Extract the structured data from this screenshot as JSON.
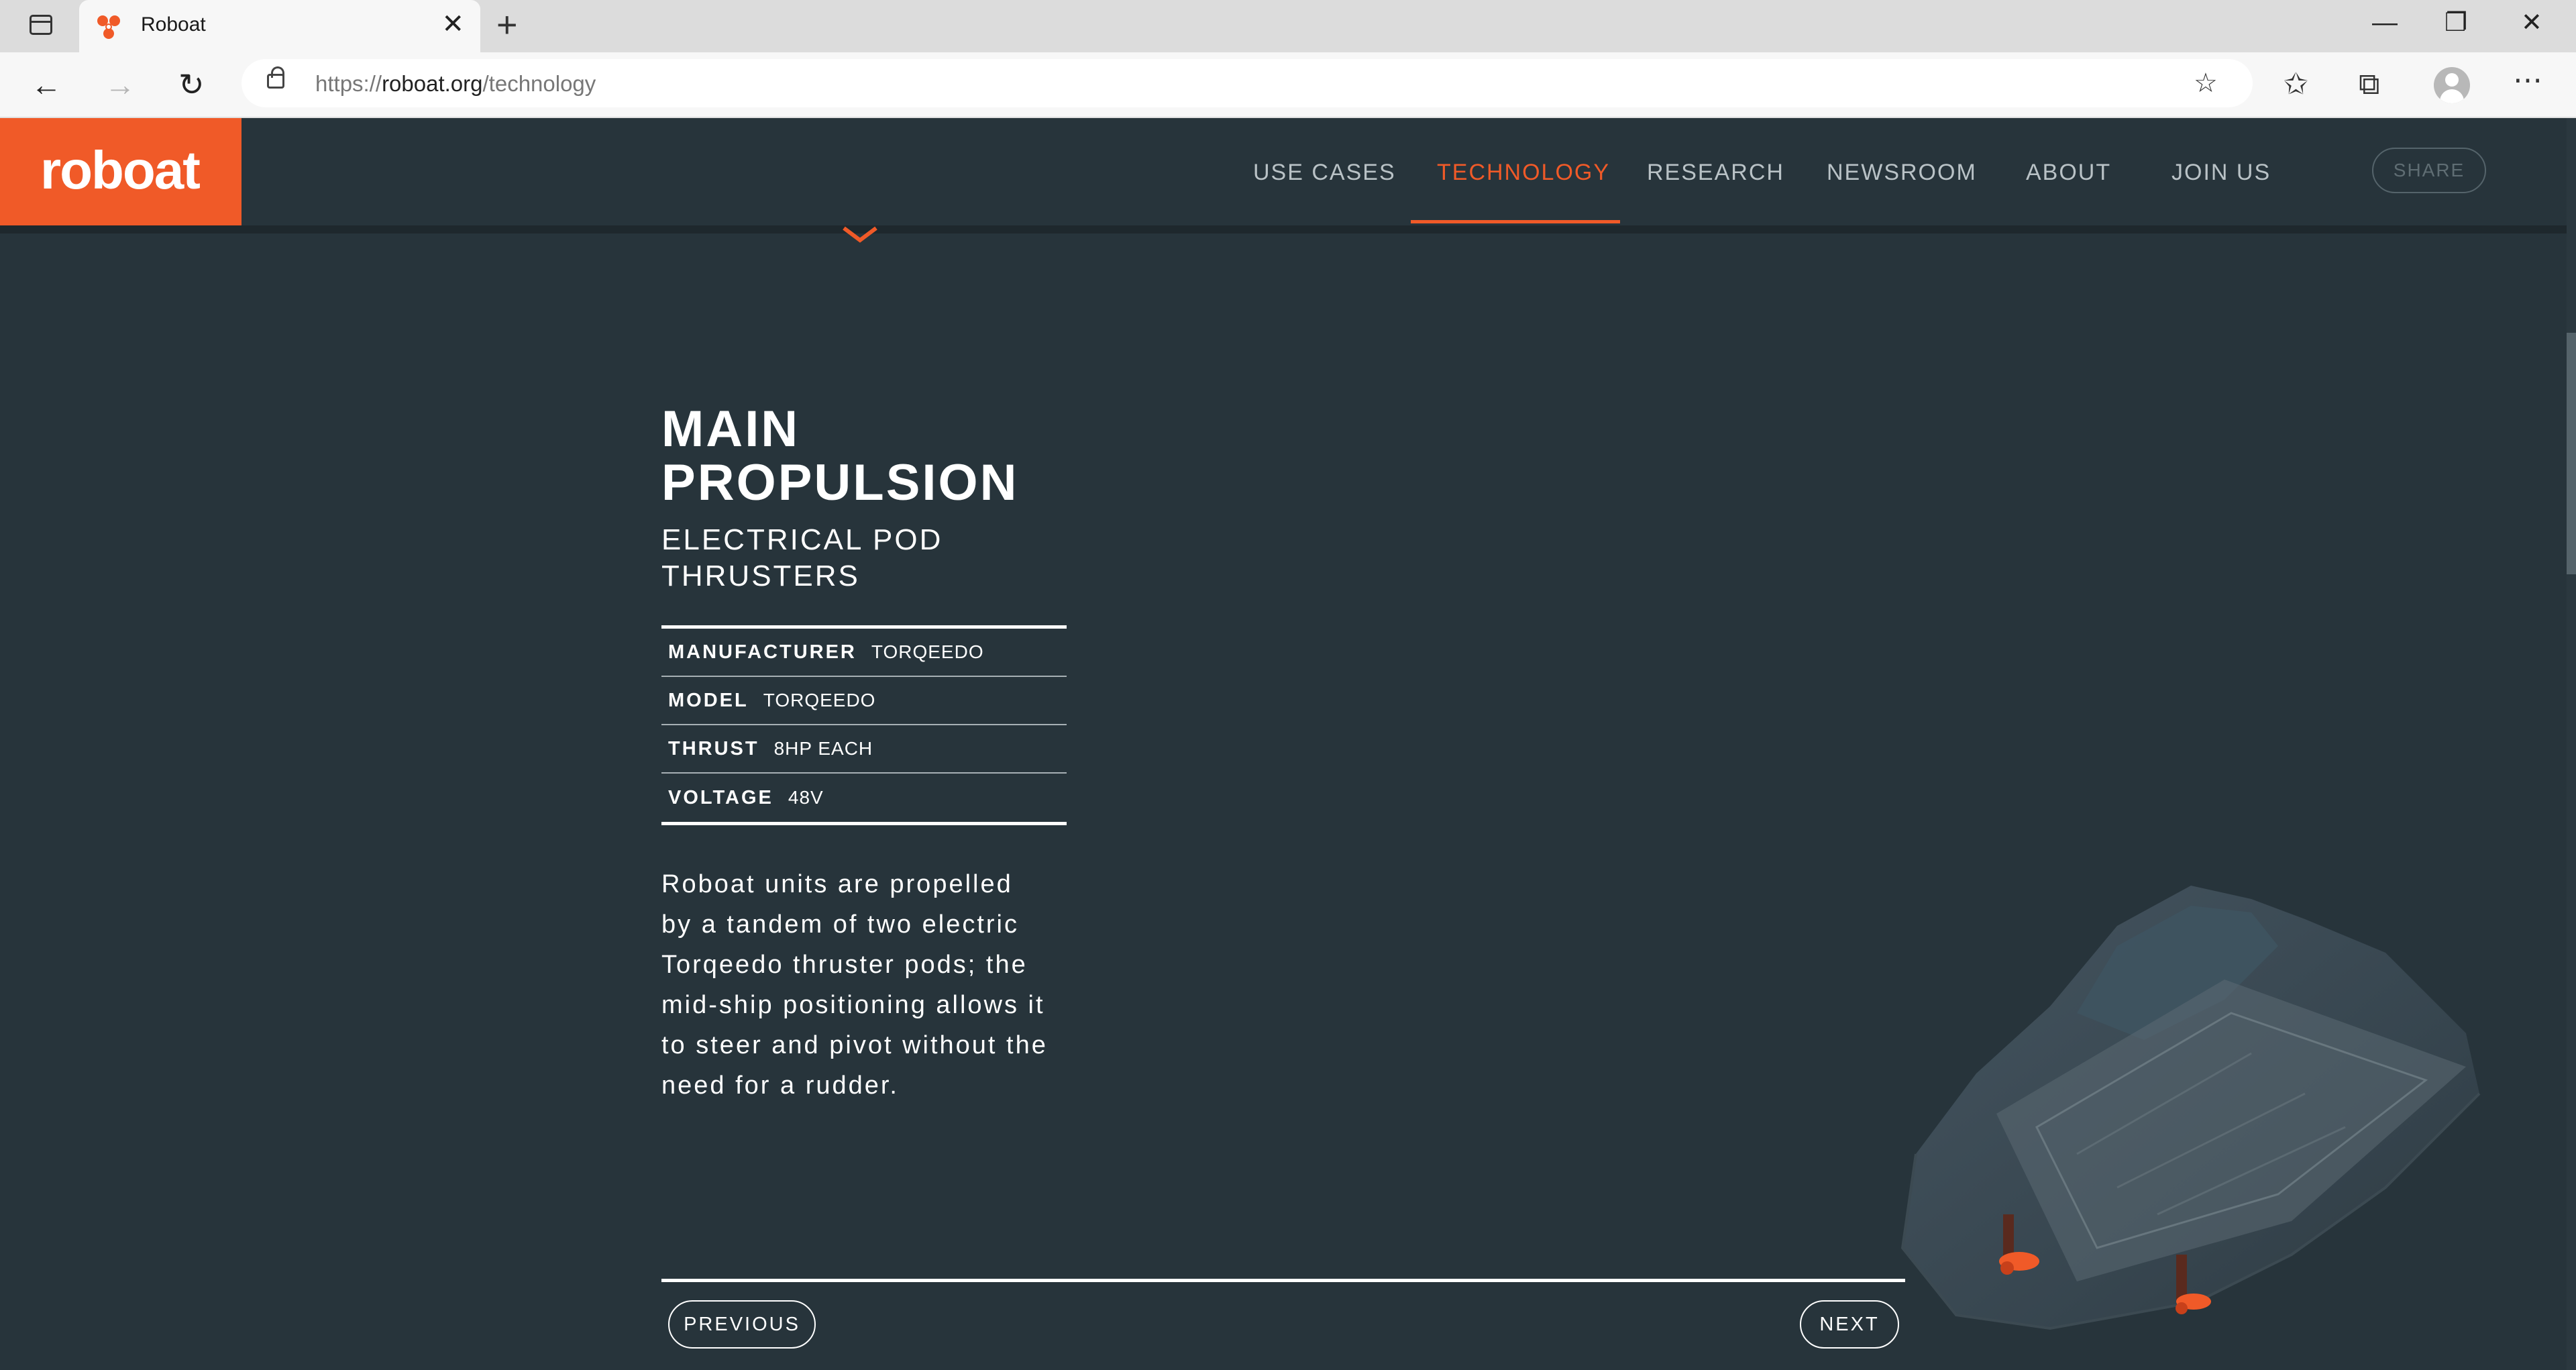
{
  "browser": {
    "tab_title": "Roboat",
    "tab_close": "✕",
    "new_tab": "+",
    "url_prefix": "https://",
    "url_domain": "roboat.org",
    "url_path": "/technology",
    "window_controls": {
      "minimize": "—",
      "maximize": "❐",
      "close": "✕"
    }
  },
  "site": {
    "logo": "roboat",
    "nav": [
      "USE CASES",
      "TECHNOLOGY",
      "RESEARCH",
      "NEWSROOM",
      "ABOUT",
      "JOIN US"
    ],
    "active_nav": "TECHNOLOGY",
    "share": "SHARE",
    "accent_color": "#f05a28",
    "background_color": "#27343b"
  },
  "section": {
    "title": "MAIN PROPULSION",
    "subtitle": "ELECTRICAL POD THRUSTERS",
    "specs": [
      {
        "label": "MANUFACTURER",
        "value": "TORQEEDO"
      },
      {
        "label": "MODEL",
        "value": "TORQEEDO"
      },
      {
        "label": "THRUST",
        "value": "8HP EACH"
      },
      {
        "label": "VOLTAGE",
        "value": "48V"
      }
    ],
    "description": "Roboat units are propelled by a tandem of two electric Torqeedo thruster pods; the mid-ship positioning allows it to steer and pivot without the need for a rudder.",
    "previous": "PREVIOUS",
    "next": "NEXT"
  }
}
